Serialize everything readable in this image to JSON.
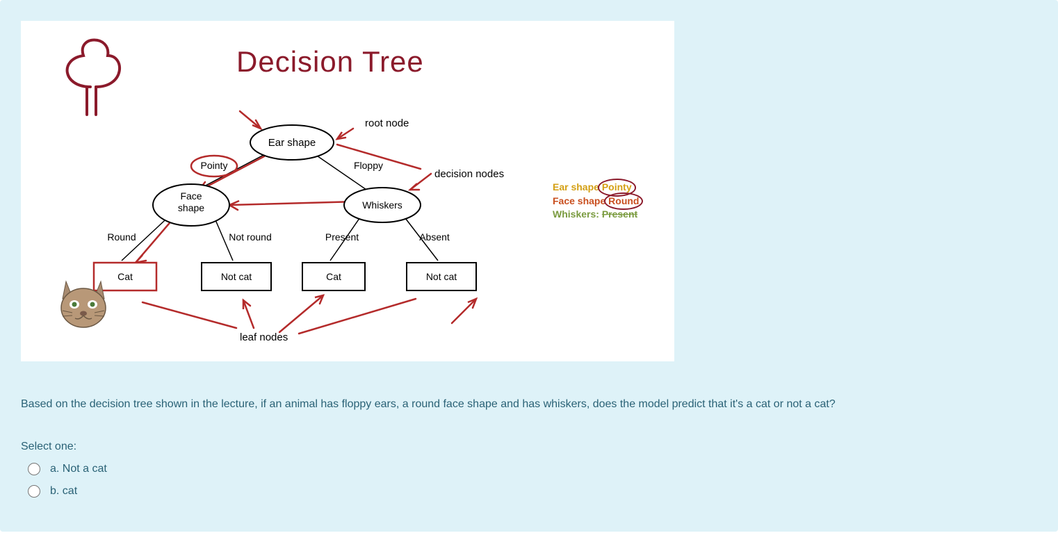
{
  "diagram": {
    "title": "Decision Tree",
    "root_label": "Ear shape",
    "left_node": "Face shape",
    "right_node": "Whiskers",
    "edge_pointy": "Pointy",
    "edge_floppy": "Floppy",
    "edge_round": "Round",
    "edge_notround": "Not round",
    "edge_present": "Present",
    "edge_absent": "Absent",
    "leaf1": "Cat",
    "leaf2": "Not cat",
    "leaf3": "Cat",
    "leaf4": "Not cat",
    "label_root": "root node",
    "label_decision": "decision nodes",
    "label_leaf": "leaf nodes",
    "annotation": {
      "line1_key": "Ear shape",
      "line1_val": "Pointy",
      "line2_key": "Face shape",
      "line2_val": "Round",
      "line3_key": "Whiskers:",
      "line3_val": "Present"
    }
  },
  "question": "Based on the decision tree shown in the lecture, if an animal has floppy ears, a round face shape and has whiskers, does the model predict that it's a cat or not a cat?",
  "select_prompt": "Select one:",
  "options": {
    "a": "a. Not a cat",
    "b": "b. cat"
  }
}
